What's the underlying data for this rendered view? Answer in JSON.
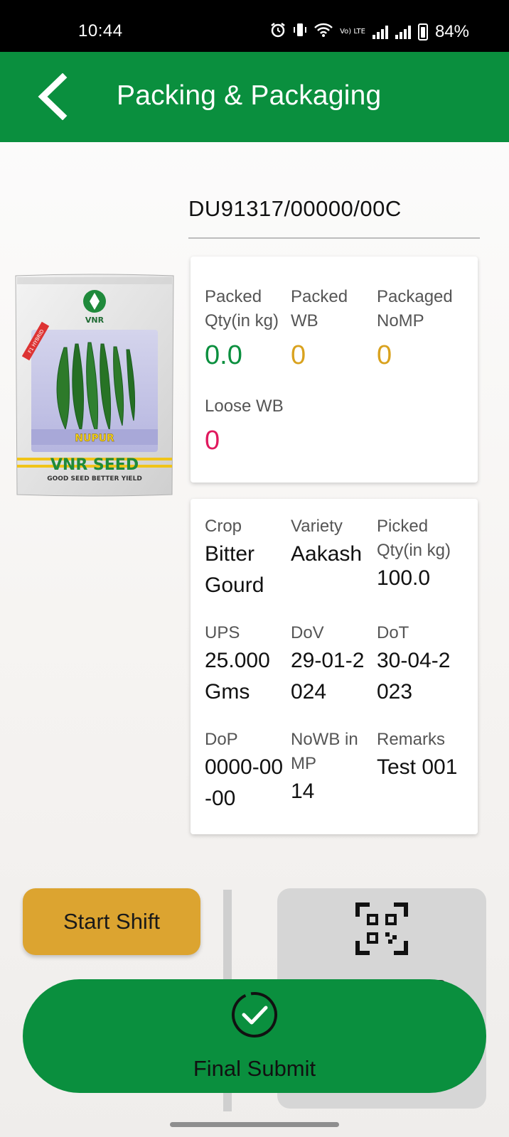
{
  "status_bar": {
    "time": "10:44",
    "battery": "84%",
    "network_label": "Vo) LTE"
  },
  "app_bar": {
    "title": "Packing & Packaging",
    "back_icon": "chevron-left-icon"
  },
  "lot_id": "DU91317/00000/00C",
  "product_image": {
    "brand_text": "VNR SEED",
    "tagline": "GOOD SEED BETTER YIELD",
    "variety_tag": "NUPUR",
    "hybrid_tag": "F1 HYBRID",
    "logo_text": "VNR"
  },
  "summary_card": {
    "packed_qty_label": "Packed Qty(in kg)",
    "packed_qty_value": "0.0",
    "packed_wb_label": "Packed WB",
    "packed_wb_value": "0",
    "packaged_nomp_label": "Packaged NoMP",
    "packaged_nomp_value": "0",
    "loose_wb_label": "Loose WB",
    "loose_wb_value": "0"
  },
  "details_card": {
    "crop_label": "Crop",
    "crop_value": "Bitter Gourd",
    "variety_label": "Variety",
    "variety_value": "Aakash",
    "picked_qty_label": "Picked Qty(in kg)",
    "picked_qty_value": "100.0",
    "ups_label": "UPS",
    "ups_value": "25.000 Gms",
    "dov_label": "DoV",
    "dov_value": "29-01-2024",
    "dot_label": "DoT",
    "dot_value": "30-04-2023",
    "dop_label": "DoP",
    "dop_value": "0000-00-00",
    "nowb_label": "NoWB in MP",
    "nowb_value": "14",
    "remarks_label": "Remarks",
    "remarks_value": "Test 001"
  },
  "actions": {
    "start_shift_label": "Start Shift",
    "scan_label": "Scan WB QR",
    "final_submit_label": "Final Submit"
  },
  "colors": {
    "primary_green": "#0a8f3e",
    "gold": "#d9a21e",
    "pink": "#e0195e",
    "start_shift_bg": "#dca430"
  }
}
